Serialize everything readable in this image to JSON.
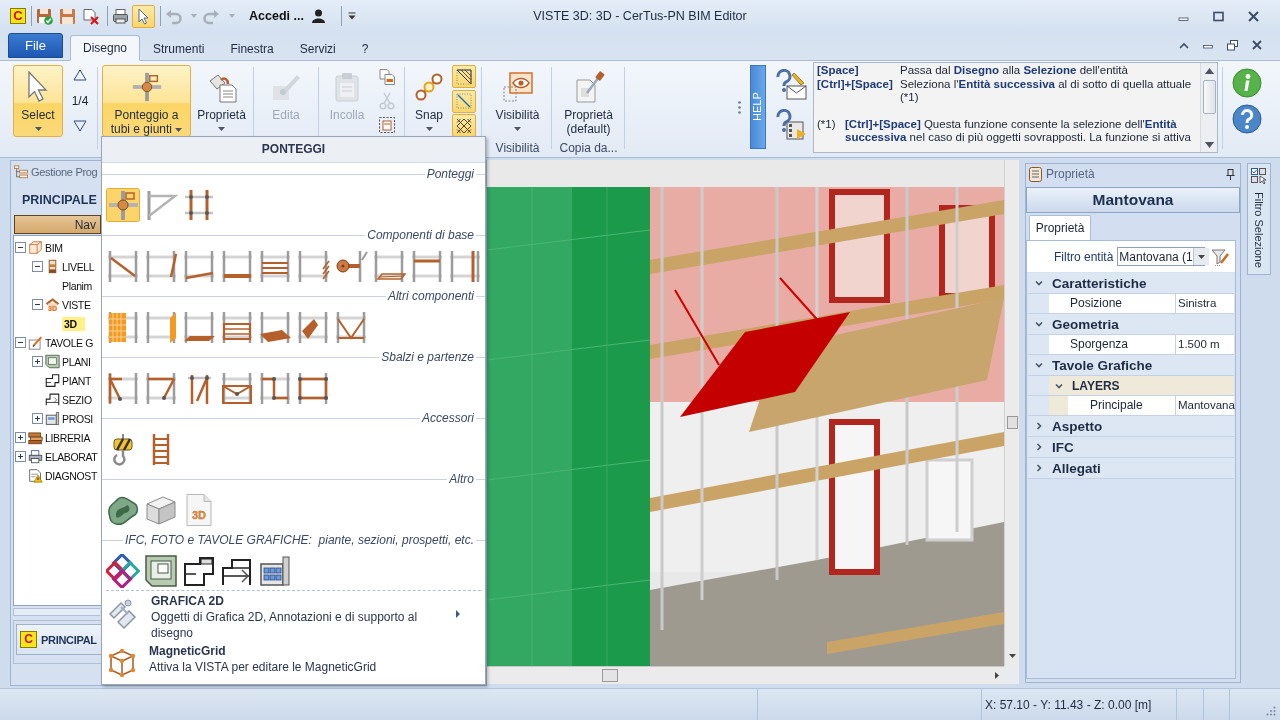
{
  "window": {
    "title": "VISTE 3D: 3D - CerTus-PN BIM Editor"
  },
  "quick_access": {
    "logo": "C",
    "select_mode_on": true,
    "undo_disabled": true,
    "redo_disabled": true,
    "user": "Accedi ..."
  },
  "ribbon": {
    "file_tab": "File",
    "tabs": [
      {
        "label": "Disegno",
        "selected": true
      },
      {
        "label": "Strumenti",
        "selected": false
      },
      {
        "label": "Finestra",
        "selected": false
      },
      {
        "label": "Servizi",
        "selected": false
      },
      {
        "label": "?",
        "selected": false
      }
    ],
    "select": {
      "label": "Select",
      "on": true
    },
    "level_counter": "1/4",
    "scaffold": {
      "label": "Ponteggio a tubi e giunti",
      "expanded": true
    },
    "properties": {
      "label": "Proprietà"
    },
    "edit": {
      "label": "Edita",
      "disabled": true
    },
    "paste": {
      "label": "Incolla",
      "disabled": true
    },
    "clipboard_tools": [
      {
        "disabled": false
      },
      {
        "disabled": true
      },
      {
        "disabled": false
      }
    ],
    "snap": {
      "label": "Snap"
    },
    "snap_toggles": [
      {
        "on": true
      },
      {
        "on": true
      },
      {
        "on": true
      }
    ],
    "visibility": {
      "label": "Visibilità",
      "group": "Visibilità"
    },
    "default_properties": {
      "label": "Proprietà (default)",
      "group": "Copia da..."
    }
  },
  "help": {
    "tab": "HELP",
    "shortcuts": [
      {
        "keys": "[Space]",
        "text": "Passa dal **Disegno** alla **Selezione** dell'entità"
      },
      {
        "keys": "[Ctrl]+[Space]",
        "text": "Seleziona l'**Entità successiva** al di sotto di quella attuale (*1)"
      }
    ],
    "notes": [
      {
        "mark": "(*1)",
        "text": "**[Ctrl]+[Space]** Questa funzione consente la selezione dell'**Entità successiva** nel caso di più oggetti sovrapposti. La funzione si attiva"
      }
    ]
  },
  "project_panel": {
    "title": "Gestione Prog",
    "project": "PRINCIPALE",
    "nav_button": "Nav",
    "tree": [
      {
        "label": "BIM",
        "expanded": true,
        "selected": false,
        "children": [
          {
            "label": "LIVELL",
            "expanded": true,
            "selected": false,
            "children": [
              {
                "label": "Planim",
                "selected": false
              }
            ]
          },
          {
            "label": "VISTE",
            "expanded": true,
            "selected": false,
            "icon_text": "3D",
            "children": [
              {
                "label": "3D",
                "selected": true
              }
            ]
          }
        ]
      },
      {
        "label": "TAVOLE G",
        "expanded": true,
        "selected": false,
        "children": [
          {
            "label": "PLANI",
            "expanded": false,
            "selected": false
          },
          {
            "label": "PIANT",
            "selected": false
          },
          {
            "label": "SEZIO",
            "selected": false
          },
          {
            "label": "PROSI",
            "expanded": false,
            "selected": false
          }
        ]
      },
      {
        "label": "LIBRERIA",
        "expanded": false,
        "selected": false
      },
      {
        "label": "ELABORAT",
        "expanded": false,
        "selected": false
      },
      {
        "label": "DIAGNOST",
        "selected": false
      }
    ],
    "bottom_tab": {
      "logo": "C",
      "label": "PRINCIPAL"
    }
  },
  "scaffold_menu": {
    "title": "PONTEGGI",
    "sections": [
      {
        "label": "Ponteggi",
        "tools": [
          {
            "selected": true
          },
          {
            "selected": false
          },
          {
            "selected": false
          }
        ]
      },
      {
        "label": "Componenti di base",
        "tools": [
          {
            "selected": false
          },
          {
            "selected": false
          },
          {
            "selected": false
          },
          {
            "selected": false
          },
          {
            "selected": false
          },
          {
            "selected": false
          },
          {
            "selected": false
          },
          {
            "selected": false
          },
          {
            "selected": false
          },
          {
            "selected": false
          }
        ]
      },
      {
        "label": "Altri componenti",
        "tools": [
          {
            "selected": false
          },
          {
            "selected": false
          },
          {
            "selected": false
          },
          {
            "selected": false
          },
          {
            "selected": false
          },
          {
            "selected": false
          },
          {
            "selected": false
          }
        ]
      },
      {
        "label": "Sbalzi e partenze",
        "tools": [
          {
            "selected": false
          },
          {
            "selected": false
          },
          {
            "selected": false
          },
          {
            "selected": false
          },
          {
            "selected": false
          },
          {
            "selected": false
          }
        ]
      },
      {
        "label": "Accessori",
        "tools": [
          {
            "selected": false
          },
          {
            "selected": false
          }
        ]
      },
      {
        "label": "Altro",
        "tools": [
          {
            "selected": false
          },
          {
            "selected": false
          },
          {
            "selected": false,
            "badge": "3D"
          }
        ]
      },
      {
        "label": "IFC, FOTO e TAVOLE GRAFICHE:  piante, sezioni, prospetti, etc.",
        "tools": [
          {
            "selected": false
          },
          {
            "selected": false
          },
          {
            "selected": false
          },
          {
            "selected": false
          },
          {
            "selected": false
          }
        ]
      }
    ],
    "commands": [
      {
        "title": "GRAFICA 2D",
        "description": "Oggetti di Grafica 2D, Annotazioni e di supporto al disegno",
        "submenu": true
      },
      {
        "title": "MagneticGrid",
        "description": "Attiva la VISTA per editare le MagneticGrid",
        "submenu": false
      }
    ]
  },
  "properties_panel": {
    "title": "Proprietà",
    "entity": "Mantovana",
    "tabs": [
      {
        "label": "Proprietà",
        "selected": true
      }
    ],
    "filter_label": "Filtro entità",
    "filter_value": "Mantovana (1",
    "categories": [
      {
        "label": "Caratteristiche",
        "expanded": true,
        "rows": [
          {
            "name": "Posizione",
            "value": "Sinistra"
          }
        ]
      },
      {
        "label": "Geometria",
        "expanded": true,
        "rows": [
          {
            "name": "Sporgenza",
            "value": "1.500 m"
          }
        ]
      },
      {
        "label": "Tavole Grafiche",
        "expanded": true,
        "subcategories": [
          {
            "label": "LAYERS",
            "expanded": true,
            "rows": [
              {
                "name": "Principale",
                "value": "Mantovana"
              }
            ]
          }
        ]
      },
      {
        "label": "Aspetto",
        "expanded": false
      },
      {
        "label": "IFC",
        "expanded": false
      },
      {
        "label": "Allegati",
        "expanded": false
      }
    ]
  },
  "side_tab": {
    "label": "Filtro Selezione"
  },
  "status_bar": {
    "coordinates": "X: 57.10 - Y: 11.43 - Z: 0.00 [m]"
  }
}
